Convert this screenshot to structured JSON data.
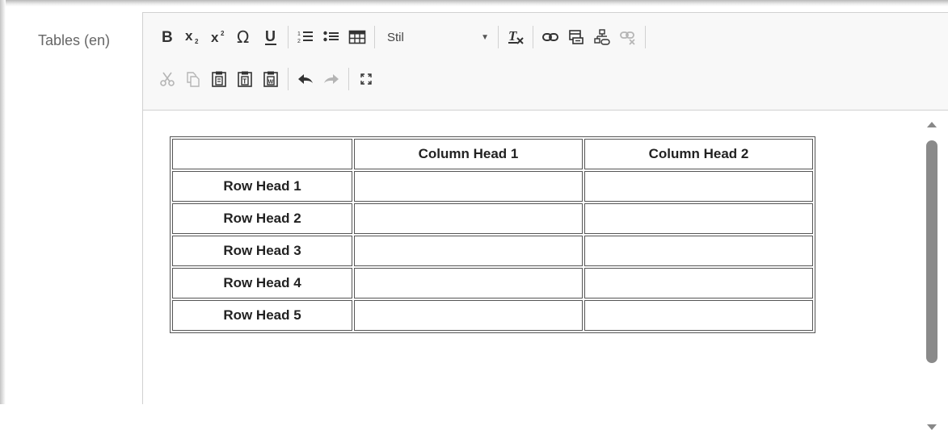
{
  "field": {
    "label": "Tables (en)"
  },
  "toolbar": {
    "styles_combo": {
      "value": "Stil"
    },
    "row1": [
      {
        "name": "bold",
        "icon": "bold-icon"
      },
      {
        "name": "subscript",
        "icon": "subscript-icon"
      },
      {
        "name": "superscript",
        "icon": "superscript-icon"
      },
      {
        "name": "special-char",
        "icon": "omega-icon"
      },
      {
        "name": "underline",
        "icon": "underline-icon"
      },
      {
        "name": "numbered-list",
        "icon": "numbered-list-icon"
      },
      {
        "name": "bulleted-list",
        "icon": "bulleted-list-icon"
      },
      {
        "name": "table",
        "icon": "table-icon"
      },
      {
        "name": "remove-format",
        "icon": "remove-format-icon"
      },
      {
        "name": "link",
        "icon": "link-icon"
      },
      {
        "name": "anchor",
        "icon": "anchor-icon"
      },
      {
        "name": "sitemap-link",
        "icon": "sitemap-link-icon"
      },
      {
        "name": "unlink",
        "icon": "unlink-icon",
        "disabled": true
      }
    ],
    "row2": [
      {
        "name": "cut",
        "icon": "scissors-icon",
        "disabled": true
      },
      {
        "name": "copy",
        "icon": "copy-icon",
        "disabled": true
      },
      {
        "name": "paste",
        "icon": "paste-icon"
      },
      {
        "name": "paste-text",
        "icon": "paste-text-icon"
      },
      {
        "name": "paste-word",
        "icon": "paste-word-icon"
      },
      {
        "name": "undo",
        "icon": "undo-icon"
      },
      {
        "name": "redo",
        "icon": "redo-icon",
        "disabled": true
      },
      {
        "name": "maximize",
        "icon": "maximize-icon"
      }
    ]
  },
  "table": {
    "header": [
      "",
      "Column Head 1",
      "Column Head 2"
    ],
    "rows": [
      [
        "Row Head 1",
        "",
        ""
      ],
      [
        "Row Head 2",
        "",
        ""
      ],
      [
        "Row Head 3",
        "",
        ""
      ],
      [
        "Row Head 4",
        "",
        ""
      ],
      [
        "Row Head 5",
        "",
        ""
      ]
    ]
  },
  "colors": {
    "toolbar_bg": "#f8f8f8",
    "icon": "#333333",
    "icon_disabled": "#b5b5b5"
  }
}
